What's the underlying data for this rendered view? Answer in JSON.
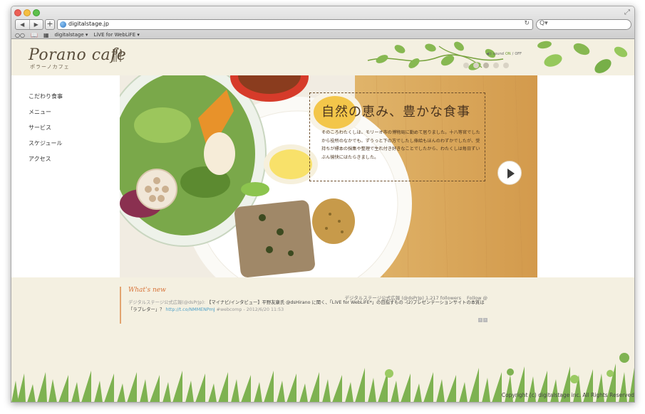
{
  "browser": {
    "url": "digitalstage.jp",
    "back": "◀",
    "forward": "▶",
    "new_tab": "+",
    "reload": "↻",
    "search_icon": "Q▾",
    "bookmarks": [
      {
        "label": "digitalstage ▾"
      },
      {
        "label": "LiVE for WebLiFE ▾"
      }
    ]
  },
  "site": {
    "logo": "Porano cafe",
    "logo_sub": "ポラーノカフェ",
    "sound": {
      "label": "sound",
      "on": "ON",
      "sep": "/",
      "off": "OFF"
    },
    "nav": [
      "こだわり食事",
      "メニュー",
      "サービス",
      "スケジュール",
      "アクセス"
    ],
    "hero": {
      "title": "自然の恵み、豊かな食事",
      "body": "そのころわたくしは、モリーオ市の博物局に勤めて居りました。十八等官でしたから役所のなかでも、ずうっと下の方でしたし俸給もほんのわずかでしたが、受持ちが標本の採集や整理で生れ付き好きなことでしたから、わたくしは毎日ずいぶん愉快にはたらきました。"
    },
    "slides": {
      "count": 5,
      "active": 2
    },
    "news": {
      "title": "What's new",
      "account": "デジタルステージ公式広報 (@dsPrJp)",
      "followers": "1,217 followers",
      "follow": "Follow @",
      "tweet_author": "デジタルステージ公式広報(@dsPrJp):",
      "tweet_text": "【マイナビ/インタビュー】平野友康氏 @dsHirano に聞く、「LiVE for WebLiFE*」の目指すもの -(2)プレゼンテーションサイトの本質は「ラブレター」？",
      "tweet_link": "http://t.co/NMMENPmJ",
      "tweet_tag": "#webcomp",
      "tweet_date": "- 2012/6/20 11:53"
    },
    "copyright": "Copyright (c) digitalstage inc. All Rights Reserved"
  },
  "colors": {
    "page_bg": "#f4f0e1",
    "leaf_green": "#7cb342",
    "accent_orange": "#d8743a",
    "text_brown": "#4b3520"
  }
}
